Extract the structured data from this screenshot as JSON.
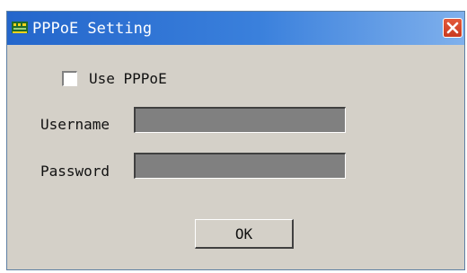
{
  "window": {
    "title": "PPPoE Setting",
    "close_icon": "close-icon"
  },
  "form": {
    "use_pppoe": {
      "label": "Use PPPoE",
      "checked": false
    },
    "username": {
      "label": "Username",
      "value": ""
    },
    "password": {
      "label": "Password",
      "value": ""
    },
    "ok_label": "OK"
  },
  "colors": {
    "titlebar": "#2466cb",
    "window_bg": "#d4d0c8",
    "field_bg": "#808080",
    "close_button": "#d64a2c"
  }
}
